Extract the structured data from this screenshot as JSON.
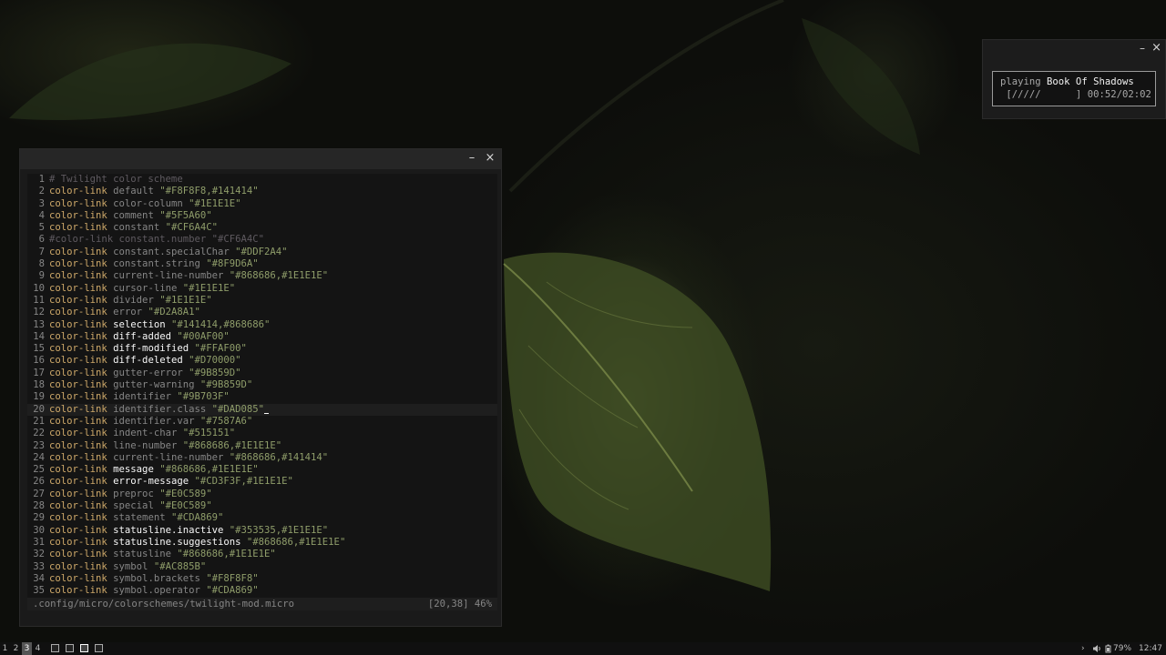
{
  "editor": {
    "title_buttons": {
      "minimize": "–",
      "close": "×"
    },
    "lines": [
      {
        "num": "1",
        "comment": "# Twilight color scheme"
      },
      {
        "num": "2",
        "kw": "color-link",
        "group": "default",
        "value": "\"#F8F8F8,#141414\""
      },
      {
        "num": "3",
        "kw": "color-link",
        "group": "color-column",
        "value": "\"#1E1E1E\""
      },
      {
        "num": "4",
        "kw": "color-link",
        "group": "comment",
        "value": "\"#5F5A60\""
      },
      {
        "num": "5",
        "kw": "color-link",
        "group": "constant",
        "value": "\"#CF6A4C\""
      },
      {
        "num": "6",
        "comment": "#color-link constant.number \"#CF6A4C\""
      },
      {
        "num": "7",
        "kw": "color-link",
        "group": "constant.specialChar",
        "value": "\"#DDF2A4\""
      },
      {
        "num": "8",
        "kw": "color-link",
        "group": "constant.string",
        "value": "\"#8F9D6A\""
      },
      {
        "num": "9",
        "kw": "color-link",
        "group": "current-line-number",
        "value": "\"#868686,#1E1E1E\""
      },
      {
        "num": "10",
        "kw": "color-link",
        "group": "cursor-line",
        "value": "\"#1E1E1E\""
      },
      {
        "num": "11",
        "kw": "color-link",
        "group": "divider",
        "value": "\"#1E1E1E\""
      },
      {
        "num": "12",
        "kw": "color-link",
        "group": "error",
        "value": "\"#D2A8A1\""
      },
      {
        "num": "13",
        "kw": "color-link",
        "group": "selection",
        "value": "\"#141414,#868686\"",
        "hl": true
      },
      {
        "num": "14",
        "kw": "color-link",
        "group": "diff-added",
        "value": "\"#00AF00\"",
        "hl": true
      },
      {
        "num": "15",
        "kw": "color-link",
        "group": "diff-modified",
        "value": "\"#FFAF00\"",
        "hl": true
      },
      {
        "num": "16",
        "kw": "color-link",
        "group": "diff-deleted",
        "value": "\"#D70000\"",
        "hl": true
      },
      {
        "num": "17",
        "kw": "color-link",
        "group": "gutter-error",
        "value": "\"#9B859D\""
      },
      {
        "num": "18",
        "kw": "color-link",
        "group": "gutter-warning",
        "value": "\"#9B859D\""
      },
      {
        "num": "19",
        "kw": "color-link",
        "group": "identifier",
        "value": "\"#9B703F\""
      },
      {
        "num": "20",
        "kw": "color-link",
        "group": "identifier.class",
        "value": "\"#DAD085\"",
        "current": true
      },
      {
        "num": "21",
        "kw": "color-link",
        "group": "identifier.var",
        "value": "\"#7587A6\""
      },
      {
        "num": "22",
        "kw": "color-link",
        "group": "indent-char",
        "value": "\"#515151\""
      },
      {
        "num": "23",
        "kw": "color-link",
        "group": "line-number",
        "value": "\"#868686,#1E1E1E\""
      },
      {
        "num": "24",
        "kw": "color-link",
        "group": "current-line-number",
        "value": "\"#868686,#141414\""
      },
      {
        "num": "25",
        "kw": "color-link",
        "group": "message",
        "value": "\"#868686,#1E1E1E\"",
        "hl": true
      },
      {
        "num": "26",
        "kw": "color-link",
        "group": "error-message",
        "value": "\"#CD3F3F,#1E1E1E\"",
        "hl": true
      },
      {
        "num": "27",
        "kw": "color-link",
        "group": "preproc",
        "value": "\"#E0C589\""
      },
      {
        "num": "28",
        "kw": "color-link",
        "group": "special",
        "value": "\"#E0C589\""
      },
      {
        "num": "29",
        "kw": "color-link",
        "group": "statement",
        "value": "\"#CDA869\""
      },
      {
        "num": "30",
        "kw": "color-link",
        "group": "statusline.inactive",
        "value": "\"#353535,#1E1E1E\"",
        "hl": true
      },
      {
        "num": "31",
        "kw": "color-link",
        "group": "statusline.suggestions",
        "value": "\"#868686,#1E1E1E\"",
        "hl": true
      },
      {
        "num": "32",
        "kw": "color-link",
        "group": "statusline",
        "value": "\"#868686,#1E1E1E\""
      },
      {
        "num": "33",
        "kw": "color-link",
        "group": "symbol",
        "value": "\"#AC885B\""
      },
      {
        "num": "34",
        "kw": "color-link",
        "group": "symbol.brackets",
        "value": "\"#F8F8F8\""
      },
      {
        "num": "35",
        "kw": "color-link",
        "group": "symbol.operator",
        "value": "\"#CDA869\""
      }
    ],
    "statusline": {
      "path": ".config/micro/colorschemes/twilight-mod.micro",
      "position": "[20,38] 46%"
    }
  },
  "music": {
    "title_buttons": {
      "minimize": "–",
      "close": "×"
    },
    "status": "playing",
    "track": "Book Of Shadows",
    "progress_bar": " [/////      ]",
    "time": "00:52/02:02",
    "progress_fraction": 0.43
  },
  "taskbar": {
    "workspaces": [
      {
        "label": "1",
        "active": false
      },
      {
        "label": "2",
        "active": false
      },
      {
        "label": "3",
        "active": true
      },
      {
        "label": "4",
        "active": false
      }
    ],
    "tasks": [
      {
        "icon": "terminal-icon",
        "active": false
      },
      {
        "icon": "editor-icon",
        "active": false
      },
      {
        "icon": "editor-icon",
        "active": true
      },
      {
        "icon": "terminal-icon",
        "active": false
      }
    ],
    "tray": {
      "arrow": "›",
      "battery": "79%",
      "clock": "12:47"
    }
  }
}
